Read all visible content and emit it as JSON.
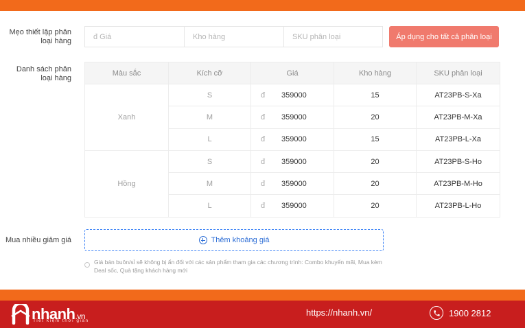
{
  "setup": {
    "label": "Mẹo thiết lập phân loại hàng",
    "price_placeholder": "đ Giá",
    "stock_placeholder": "Kho hàng",
    "sku_placeholder": "SKU phân loại",
    "apply_label": "Áp dụng cho tất cả phân loại"
  },
  "variants": {
    "label": "Danh sách phân loại hàng",
    "headers": {
      "color": "Màu sắc",
      "size": "Kích cỡ",
      "price": "Giá",
      "stock": "Kho hàng",
      "sku": "SKU phân loại"
    },
    "currency": "đ",
    "groups": [
      {
        "color": "Xanh",
        "rows": [
          {
            "size": "S",
            "price": "359000",
            "stock": "15",
            "sku": "AT23PB-S-Xa"
          },
          {
            "size": "M",
            "price": "359000",
            "stock": "20",
            "sku": "AT23PB-M-Xa"
          },
          {
            "size": "L",
            "price": "359000",
            "stock": "15",
            "sku": "AT23PB-L-Xa"
          }
        ]
      },
      {
        "color": "Hồng",
        "rows": [
          {
            "size": "S",
            "price": "359000",
            "stock": "20",
            "sku": "AT23PB-S-Ho"
          },
          {
            "size": "M",
            "price": "359000",
            "stock": "20",
            "sku": "AT23PB-M-Ho"
          },
          {
            "size": "L",
            "price": "359000",
            "stock": "20",
            "sku": "AT23PB-L-Ho"
          }
        ]
      }
    ]
  },
  "bulk": {
    "label": "Mua nhiều giảm giá",
    "add_label": "Thêm khoảng giá",
    "note": "Giá bán buôn/sỉ sẽ không bị ẩn đối với các sản phẩm tham gia các chương trình: Combo khuyến mãi, Mua kèm Deal sốc, Quà tặng khách hàng mới"
  },
  "footer": {
    "brand": "nhanh",
    "brand_suffix": ".vn",
    "tagline": "Tiết kiệm thời gian",
    "url": "https://nhanh.vn/",
    "phone": "1900 2812"
  },
  "colors": {
    "accent_orange": "#f26a1b",
    "footer_red": "#c81e1e",
    "apply_button": "#f07a6d",
    "link_blue": "#2f6fd6"
  }
}
